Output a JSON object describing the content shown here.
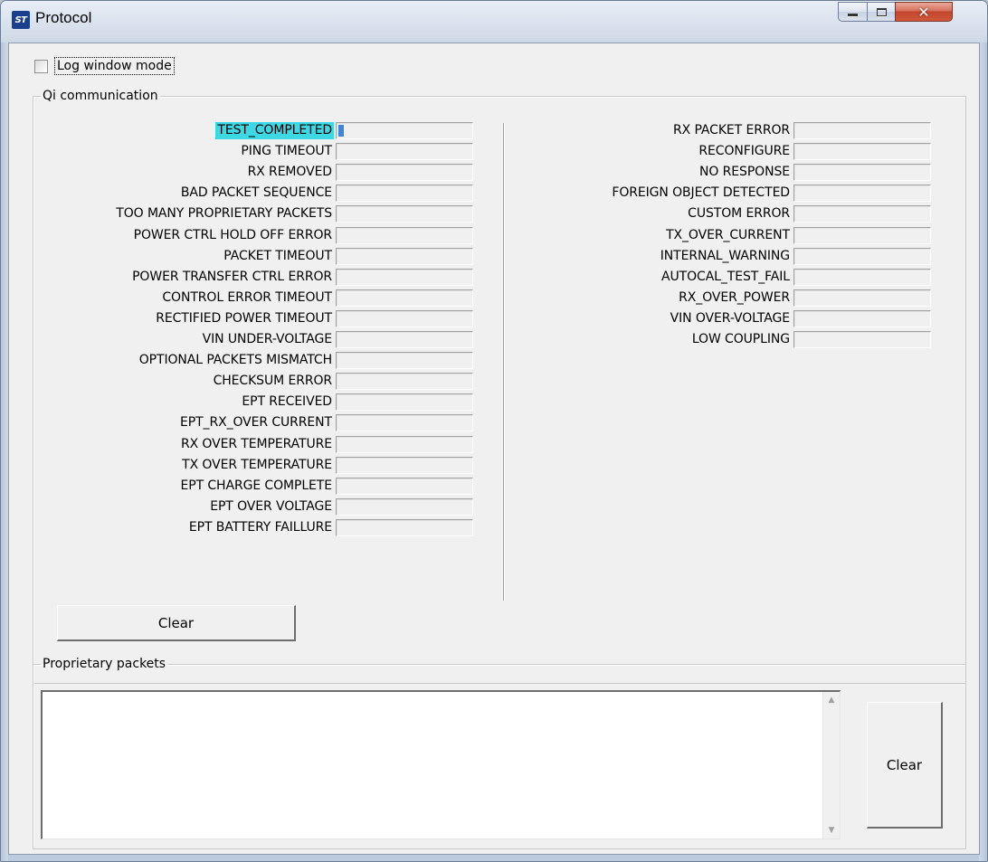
{
  "window": {
    "title": "Protocol",
    "icon_label": "ST",
    "close_glyph": "✕"
  },
  "log_window_mode": {
    "label": "Log window mode",
    "checked": false
  },
  "qi": {
    "legend": "Qi communication",
    "left_items": [
      {
        "label": "TEST_COMPLETED",
        "highlighted": true,
        "fill": 0.04
      },
      {
        "label": "PING TIMEOUT"
      },
      {
        "label": "RX REMOVED"
      },
      {
        "label": "BAD PACKET SEQUENCE"
      },
      {
        "label": "TOO MANY PROPRIETARY PACKETS"
      },
      {
        "label": "POWER CTRL HOLD OFF ERROR"
      },
      {
        "label": "PACKET TIMEOUT"
      },
      {
        "label": "POWER TRANSFER CTRL ERROR"
      },
      {
        "label": "CONTROL ERROR TIMEOUT"
      },
      {
        "label": "RECTIFIED POWER TIMEOUT"
      },
      {
        "label": "VIN UNDER-VOLTAGE"
      },
      {
        "label": "OPTIONAL PACKETS MISMATCH"
      },
      {
        "label": "CHECKSUM ERROR"
      },
      {
        "label": "EPT RECEIVED"
      },
      {
        "label": "EPT_RX_OVER CURRENT"
      },
      {
        "label": "RX OVER TEMPERATURE"
      },
      {
        "label": "TX OVER TEMPERATURE"
      },
      {
        "label": "EPT CHARGE COMPLETE"
      },
      {
        "label": "EPT OVER VOLTAGE"
      },
      {
        "label": "EPT BATTERY FAILLURE"
      }
    ],
    "right_items": [
      {
        "label": "RX PACKET ERROR"
      },
      {
        "label": "RECONFIGURE"
      },
      {
        "label": "NO RESPONSE"
      },
      {
        "label": "FOREIGN OBJECT DETECTED"
      },
      {
        "label": "CUSTOM ERROR"
      },
      {
        "label": "TX_OVER_CURRENT"
      },
      {
        "label": "INTERNAL_WARNING"
      },
      {
        "label": "AUTOCAL_TEST_FAIL"
      },
      {
        "label": "RX_OVER_POWER"
      },
      {
        "label": "VIN OVER-VOLTAGE"
      },
      {
        "label": "LOW COUPLING"
      }
    ],
    "clear_label": "Clear"
  },
  "proprietary": {
    "legend": "Proprietary packets",
    "text": "",
    "clear_label": "Clear"
  },
  "colors": {
    "highlight": "#3ed8e4",
    "progress": "#3c86dc"
  }
}
